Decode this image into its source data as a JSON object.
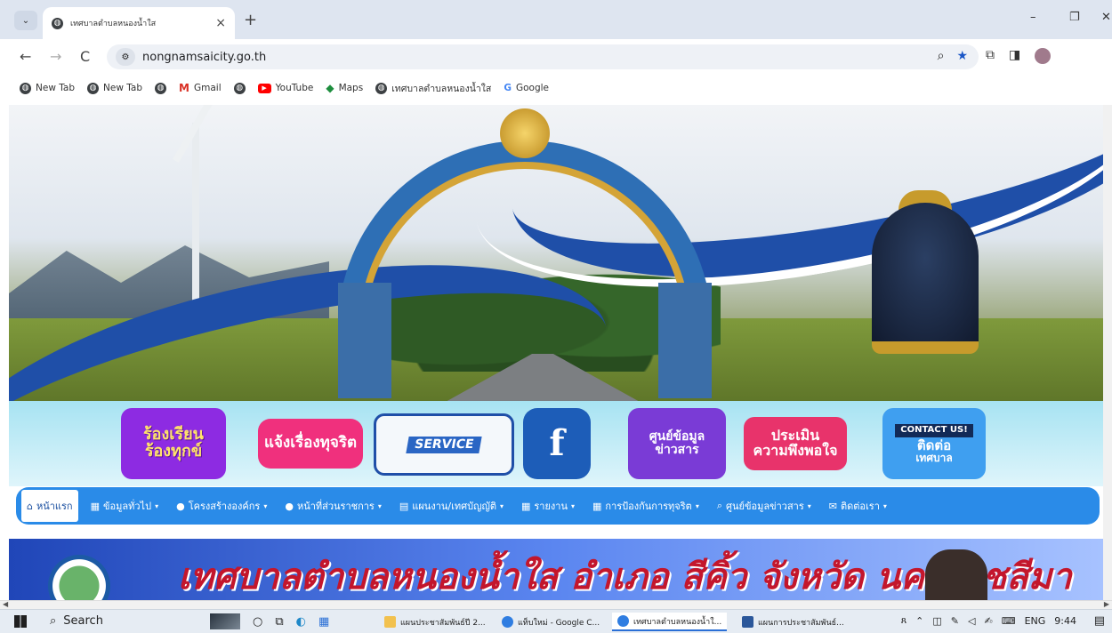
{
  "browser": {
    "tab": {
      "title": "เทศบาลตำบลหนองน้ำใส",
      "close": "×"
    },
    "new_tab": "+",
    "tab_menu": "⌄",
    "window_controls": {
      "minimize": "–",
      "restore": "❐",
      "close": "✕"
    },
    "nav": {
      "back": "←",
      "forward": "→",
      "reload": "C"
    },
    "url": "nongnamsaicity.go.th",
    "bookmarks": [
      {
        "label": "New Tab",
        "icon": "globe-icon"
      },
      {
        "label": "New Tab",
        "icon": "globe-icon"
      },
      {
        "label": "",
        "icon": "globe-icon"
      },
      {
        "label": "Gmail",
        "icon": "gmail-icon"
      },
      {
        "label": "",
        "icon": "globe-icon"
      },
      {
        "label": "YouTube",
        "icon": "youtube-icon"
      },
      {
        "label": "Maps",
        "icon": "maps-icon"
      },
      {
        "label": "เทศบาลตำบลหนองน้ำใส",
        "icon": "globe-icon"
      },
      {
        "label": "Google",
        "icon": "google-icon"
      }
    ]
  },
  "services": [
    {
      "line1": "ร้องเรียน",
      "line2": "ร้องทุกข์"
    },
    {
      "line1": "แจ้งเรื่องทุจริต",
      "line2": ""
    },
    {
      "line1": "SERVICE",
      "line2": ""
    },
    {
      "line1": "f",
      "line2": ""
    },
    {
      "line1": "ศูนย์ข้อมูล",
      "line2": "ข่าวสาร"
    },
    {
      "line1": "ประเมิน",
      "line2": "ความพึงพอใจ"
    },
    {
      "line1": "CONTACT US!",
      "line2": "ติดต่อ",
      "line3": "เทศบาล"
    }
  ],
  "nav": [
    {
      "label": "หน้าแรก",
      "icon": "home-icon",
      "glyph": "⌂",
      "active": true,
      "caret": ""
    },
    {
      "label": "ข้อมูลทั่วไป",
      "icon": "grid-icon",
      "glyph": "▦",
      "caret": "▾"
    },
    {
      "label": "โครงสร้างองค์กร",
      "icon": "user-icon",
      "glyph": "●",
      "caret": "▾"
    },
    {
      "label": "หน้าที่ส่วนราชการ",
      "icon": "user-icon",
      "glyph": "●",
      "caret": "▾"
    },
    {
      "label": "แผนงาน/เทศบัญญัติ",
      "icon": "list-icon",
      "glyph": "▤",
      "caret": "▾"
    },
    {
      "label": "รายงาน",
      "icon": "grid-icon",
      "glyph": "▦",
      "caret": "▾"
    },
    {
      "label": "การป้องกันการทุจริต",
      "icon": "grid-icon",
      "glyph": "▦",
      "caret": "▾"
    },
    {
      "label": "ศูนย์ข้อมูลข่าวสาร",
      "icon": "search-icon",
      "glyph": "⌕",
      "caret": "▾"
    },
    {
      "label": "ติดต่อเรา",
      "icon": "mail-icon",
      "glyph": "✉",
      "caret": "▾"
    }
  ],
  "title_banner": {
    "text": "เทศบาลตำบลหนองน้ำใส อำเภอ สีคิ้ว จังหวัด นครราชสีมา"
  },
  "taskbar": {
    "search": "Search",
    "apps": [
      {
        "label": "แผนประชาสัมพันธ์ปี 2...",
        "color": "#f2c14e"
      },
      {
        "label": "แท็บใหม่ - Google C...",
        "color": "#2f7de1"
      },
      {
        "label": "เทศบาลตำบลหนองน้ำใ...",
        "color": "#2f7de1"
      },
      {
        "label": "แผนการประชาสัมพันธ์...",
        "color": "#2b579a"
      }
    ],
    "lang": "ENG",
    "time": "9:44"
  }
}
